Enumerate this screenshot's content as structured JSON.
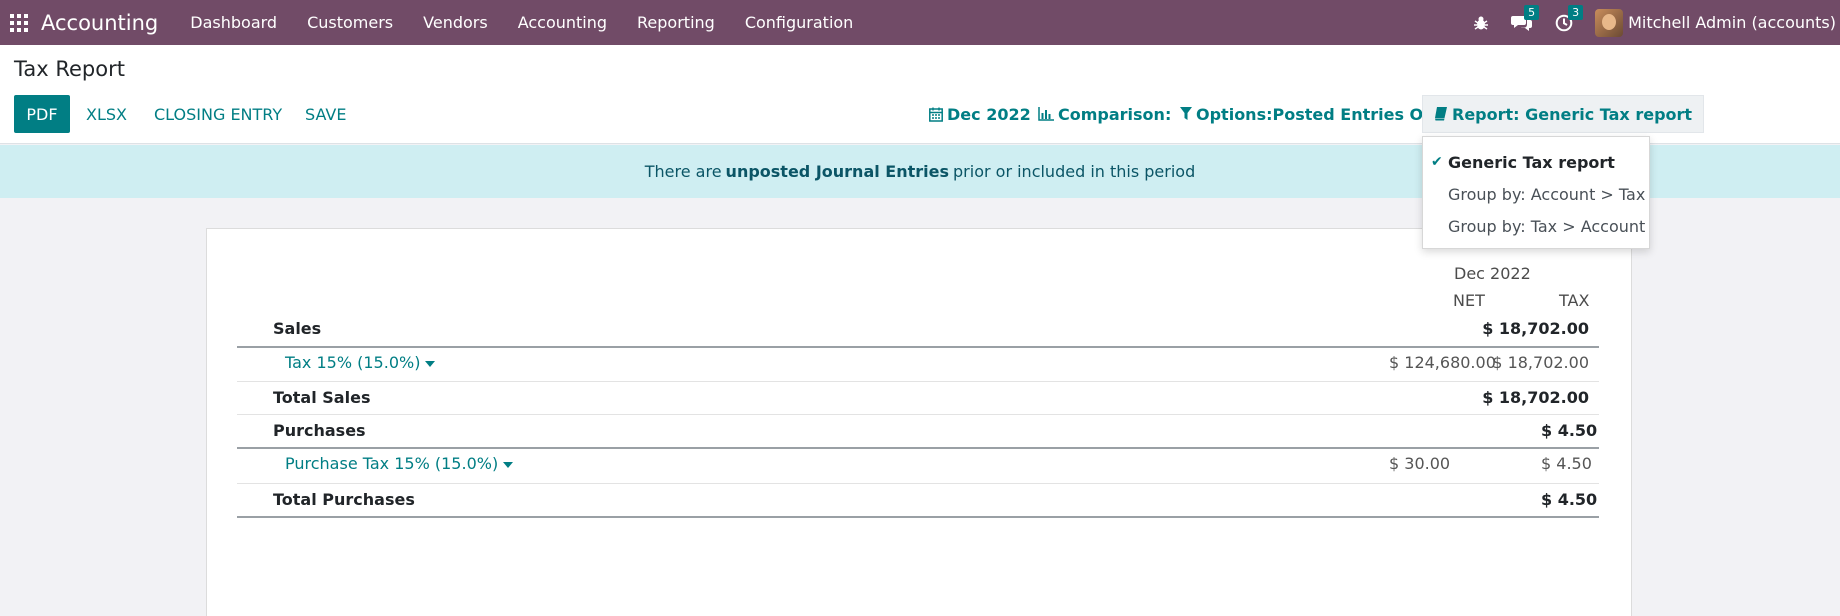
{
  "navbar": {
    "brand": "Accounting",
    "menu": [
      "Dashboard",
      "Customers",
      "Vendors",
      "Accounting",
      "Reporting",
      "Configuration"
    ],
    "messages_count": "5",
    "activities_count": "3",
    "user_name": "Mitchell Admin (accounts)",
    "bg_color": "#714b67"
  },
  "control_panel": {
    "title": "Tax Report",
    "buttons": {
      "pdf": "PDF",
      "xlsx": "XLSX",
      "closing_entry": "CLOSING ENTRY",
      "save": "SAVE"
    },
    "filters": {
      "date": "Dec 2022",
      "comparison": "Comparison:",
      "options": "Options:Posted Entries Only",
      "report": "Report: Generic Tax report"
    }
  },
  "alert": {
    "prefix": "There are",
    "link": "unposted Journal Entries",
    "suffix": "prior or included in this period"
  },
  "dropdown": {
    "items": [
      {
        "label": "Generic Tax report",
        "selected": true
      },
      {
        "label": "Group by: Account > Tax",
        "selected": false
      },
      {
        "label": "Group by: Tax > Account",
        "selected": false
      }
    ]
  },
  "report": {
    "period": "Dec 2022",
    "columns": {
      "net": "NET",
      "tax": "TAX"
    },
    "rows": [
      {
        "label": "Sales",
        "net": "",
        "tax": "$ 18,702.00"
      },
      {
        "label": "Tax 15% (15.0%)",
        "net": "$ 124,680.00",
        "tax": "$ 18,702.00"
      },
      {
        "label": "Total Sales",
        "net": "",
        "tax": "$ 18,702.00"
      },
      {
        "label": "Purchases",
        "net": "",
        "tax": "$ 4.50"
      },
      {
        "label": "Purchase Tax 15% (15.0%)",
        "net": "$ 30.00",
        "tax": "$ 4.50"
      },
      {
        "label": "Total Purchases",
        "net": "",
        "tax": "$ 4.50"
      }
    ]
  },
  "colors": {
    "accent": "#017e84",
    "alert_bg": "#cfeef2"
  }
}
